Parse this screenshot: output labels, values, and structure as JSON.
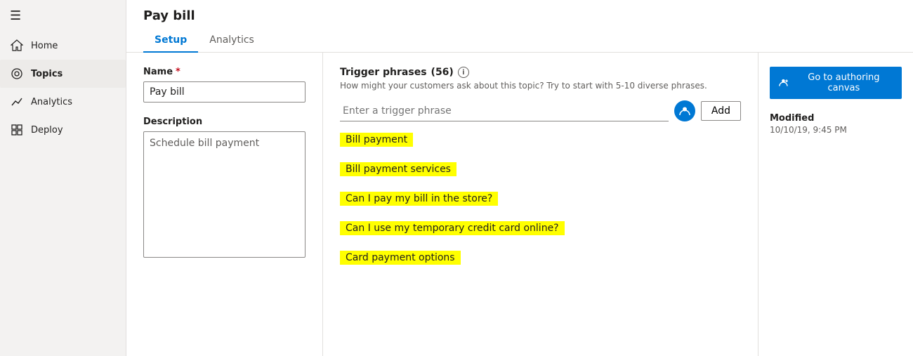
{
  "sidebar": {
    "hamburger": "☰",
    "items": [
      {
        "id": "home",
        "label": "Home",
        "icon": "home"
      },
      {
        "id": "topics",
        "label": "Topics",
        "icon": "topics",
        "active": true
      },
      {
        "id": "analytics",
        "label": "Analytics",
        "icon": "analytics"
      },
      {
        "id": "deploy",
        "label": "Deploy",
        "icon": "deploy"
      }
    ]
  },
  "page": {
    "title": "Pay bill",
    "tabs": [
      {
        "id": "setup",
        "label": "Setup",
        "active": true
      },
      {
        "id": "analytics",
        "label": "Analytics",
        "active": false
      }
    ]
  },
  "name_field": {
    "label": "Name",
    "required": true,
    "value": "Pay bill",
    "placeholder": ""
  },
  "description_field": {
    "label": "Description",
    "value": "Schedule bill payment",
    "placeholder": "Schedule bill payment"
  },
  "trigger_phrases": {
    "title": "Trigger phrases",
    "count": "(56)",
    "hint": "How might your customers ask about this topic? Try to start with 5-10 diverse phrases.",
    "input_placeholder": "Enter a trigger phrase",
    "add_button": "Add",
    "phrases": [
      "Bill payment",
      "Bill payment services",
      "Can I pay my bill in the store?",
      "Can I use my temporary credit card online?",
      "Card payment options"
    ]
  },
  "right_panel": {
    "authoring_button": "Go to authoring canvas",
    "modified_label": "Modified",
    "modified_value": "10/10/19, 9:45 PM"
  },
  "icons": {
    "home": "⌂",
    "topics": "◎",
    "analytics": "↗",
    "deploy": "⊞",
    "info": "i",
    "avatar": "👤",
    "authoring": "⊕"
  }
}
